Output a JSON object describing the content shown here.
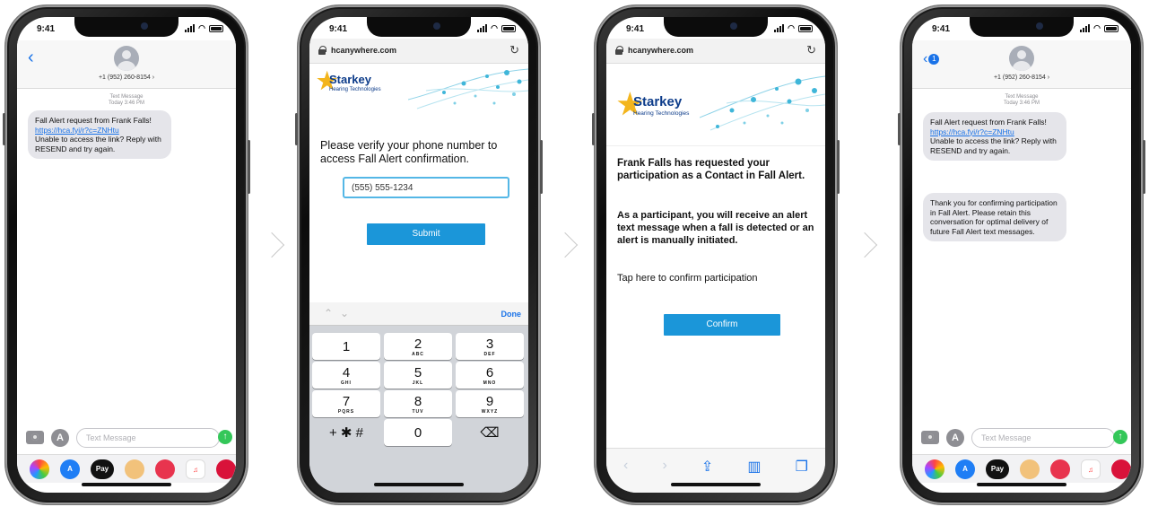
{
  "status": {
    "time": "9:41"
  },
  "messages": {
    "contact": "+1 (952) 260-8154 ›",
    "meta_line1": "Text Message",
    "meta_line2": "Today 3:46 PM",
    "bubble1_line1": "Fall Alert request from Frank Falls!",
    "bubble1_link": "https://hca.fyi/r?c=ZNHtu",
    "bubble1_line2": "Unable to access the link? Reply with RESEND and try again.",
    "bubble2": "Thank you for confirming participation in Fall Alert. Please retain this conversation for optimal delivery of future Fall Alert text messages.",
    "input_placeholder": "Text Message",
    "back_badge": "1"
  },
  "browser": {
    "url": "hcanywhere.com",
    "brand_name": "Starkey",
    "brand_sub": "Hearing Technologies"
  },
  "verify": {
    "prompt": "Please verify your phone number to access Fall Alert confirmation.",
    "phone_value": "(555) 555-1234",
    "submit_label": "Submit",
    "done_label": "Done",
    "keys": [
      {
        "digit": "1",
        "letters": ""
      },
      {
        "digit": "2",
        "letters": "ABC"
      },
      {
        "digit": "3",
        "letters": "DEF"
      },
      {
        "digit": "4",
        "letters": "GHI"
      },
      {
        "digit": "5",
        "letters": "JKL"
      },
      {
        "digit": "6",
        "letters": "MNO"
      },
      {
        "digit": "7",
        "letters": "PQRS"
      },
      {
        "digit": "8",
        "letters": "TUV"
      },
      {
        "digit": "9",
        "letters": "WXYZ"
      },
      {
        "digit": "+ ✱ #",
        "letters": ""
      },
      {
        "digit": "0",
        "letters": ""
      },
      {
        "digit": "⌫",
        "letters": ""
      }
    ]
  },
  "confirm": {
    "heading": "Frank Falls has requested your participation as a Contact in Fall Alert.",
    "body": "As a participant, you will receive an alert text message when a fall is detected or an alert is manually initiated.",
    "tap_text": "Tap here to confirm participation",
    "confirm_label": "Confirm"
  },
  "colors": {
    "accent": "#1b96d9",
    "link": "#1a73e8",
    "bubble": "#e5e5ea",
    "brand": "#0d3c8a"
  }
}
